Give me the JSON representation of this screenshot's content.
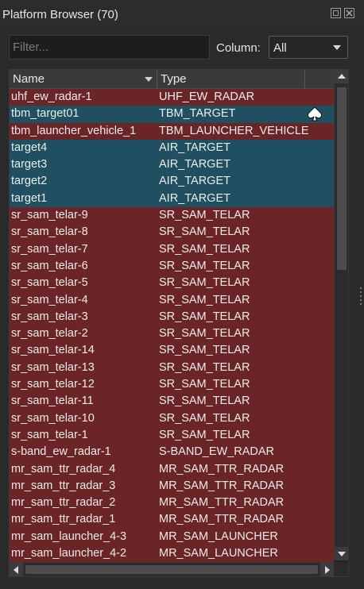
{
  "window": {
    "title": "Platform Browser (70)",
    "float_icon": "float-window-icon",
    "close_icon": "close-icon"
  },
  "filter": {
    "placeholder": "Filter...",
    "value": ""
  },
  "column": {
    "label": "Column:",
    "selected": "All"
  },
  "table": {
    "headers": {
      "name": "Name",
      "type": "Type"
    },
    "colors": {
      "red": "#6b2526",
      "blue": "#1f4f60"
    },
    "rows": [
      {
        "name": "uhf_ew_radar-1",
        "type": "UHF_EW_RADAR",
        "color": "red"
      },
      {
        "name": "tbm_target01",
        "type": "TBM_TARGET",
        "color": "blue",
        "icon": "spade-icon"
      },
      {
        "name": "tbm_launcher_vehicle_1",
        "type": "TBM_LAUNCHER_VEHICLE",
        "color": "red"
      },
      {
        "name": "target4",
        "type": "AIR_TARGET",
        "color": "blue"
      },
      {
        "name": "target3",
        "type": "AIR_TARGET",
        "color": "blue"
      },
      {
        "name": "target2",
        "type": "AIR_TARGET",
        "color": "blue"
      },
      {
        "name": "target1",
        "type": "AIR_TARGET",
        "color": "blue"
      },
      {
        "name": "sr_sam_telar-9",
        "type": "SR_SAM_TELAR",
        "color": "red"
      },
      {
        "name": "sr_sam_telar-8",
        "type": "SR_SAM_TELAR",
        "color": "red"
      },
      {
        "name": "sr_sam_telar-7",
        "type": "SR_SAM_TELAR",
        "color": "red"
      },
      {
        "name": "sr_sam_telar-6",
        "type": "SR_SAM_TELAR",
        "color": "red"
      },
      {
        "name": "sr_sam_telar-5",
        "type": "SR_SAM_TELAR",
        "color": "red"
      },
      {
        "name": "sr_sam_telar-4",
        "type": "SR_SAM_TELAR",
        "color": "red"
      },
      {
        "name": "sr_sam_telar-3",
        "type": "SR_SAM_TELAR",
        "color": "red"
      },
      {
        "name": "sr_sam_telar-2",
        "type": "SR_SAM_TELAR",
        "color": "red"
      },
      {
        "name": "sr_sam_telar-14",
        "type": "SR_SAM_TELAR",
        "color": "red"
      },
      {
        "name": "sr_sam_telar-13",
        "type": "SR_SAM_TELAR",
        "color": "red"
      },
      {
        "name": "sr_sam_telar-12",
        "type": "SR_SAM_TELAR",
        "color": "red"
      },
      {
        "name": "sr_sam_telar-11",
        "type": "SR_SAM_TELAR",
        "color": "red"
      },
      {
        "name": "sr_sam_telar-10",
        "type": "SR_SAM_TELAR",
        "color": "red"
      },
      {
        "name": "sr_sam_telar-1",
        "type": "SR_SAM_TELAR",
        "color": "red"
      },
      {
        "name": "s-band_ew_radar-1",
        "type": "S-BAND_EW_RADAR",
        "color": "red"
      },
      {
        "name": "mr_sam_ttr_radar_4",
        "type": "MR_SAM_TTR_RADAR",
        "color": "red"
      },
      {
        "name": "mr_sam_ttr_radar_3",
        "type": "MR_SAM_TTR_RADAR",
        "color": "red"
      },
      {
        "name": "mr_sam_ttr_radar_2",
        "type": "MR_SAM_TTR_RADAR",
        "color": "red"
      },
      {
        "name": "mr_sam_ttr_radar_1",
        "type": "MR_SAM_TTR_RADAR",
        "color": "red"
      },
      {
        "name": "mr_sam_launcher_4-3",
        "type": "MR_SAM_LAUNCHER",
        "color": "red"
      },
      {
        "name": "mr_sam_launcher_4-2",
        "type": "MR_SAM_LAUNCHER",
        "color": "red"
      }
    ]
  }
}
